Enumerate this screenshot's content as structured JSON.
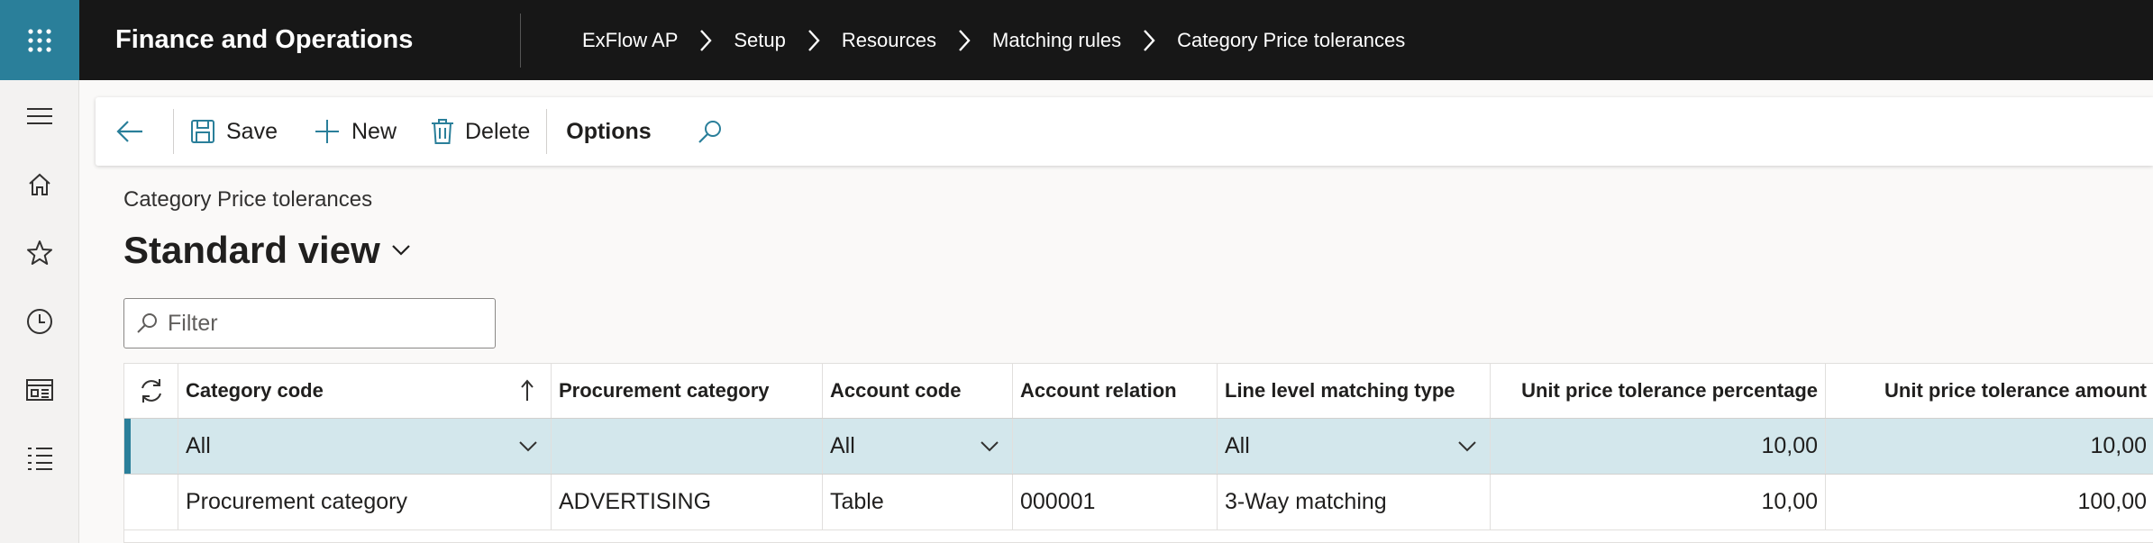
{
  "topbar": {
    "app_title": "Finance and Operations",
    "breadcrumbs": [
      "ExFlow AP",
      "Setup",
      "Resources",
      "Matching rules",
      "Category Price tolerances"
    ]
  },
  "nav": {
    "icons": [
      "menu-icon",
      "home-icon",
      "star-icon",
      "clock-icon",
      "workspace-icon",
      "list-icon"
    ]
  },
  "actions": {
    "save": "Save",
    "new": "New",
    "delete": "Delete",
    "options": "Options"
  },
  "page": {
    "caption": "Category Price tolerances",
    "view_title": "Standard view",
    "filter_placeholder": "Filter"
  },
  "grid": {
    "headers": [
      "Category code",
      "Procurement category",
      "Account code",
      "Account relation",
      "Line level matching type",
      "Unit price tolerance percentage",
      "Unit price tolerance amount"
    ],
    "rows": [
      [
        "All",
        "",
        "All",
        "",
        "All",
        "10,00",
        "10,00"
      ],
      [
        "Procurement category",
        "ADVERTISING",
        "Table",
        "000001",
        "3-Way matching",
        "10,00",
        "100,00"
      ]
    ]
  },
  "colors": {
    "topbar": "#171717",
    "accent": "#2a7f9a",
    "selected_row": "#d3e7ec"
  }
}
